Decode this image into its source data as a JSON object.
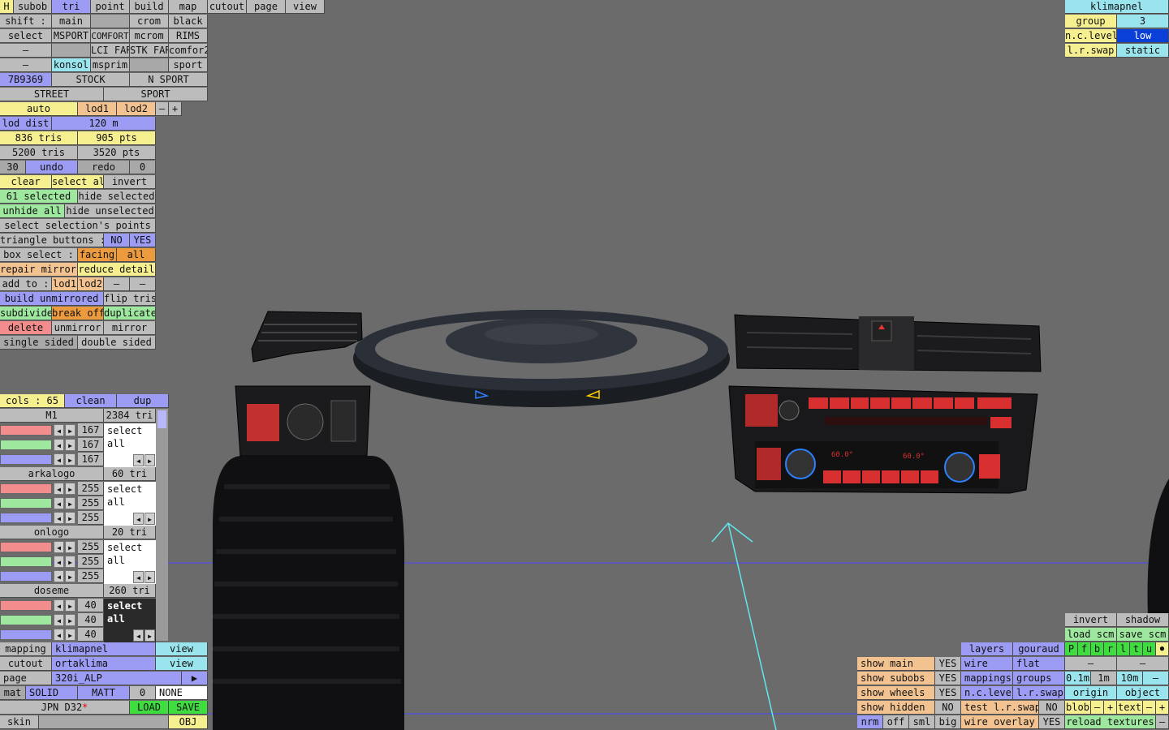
{
  "toolbar": {
    "h": "H",
    "subob": "subob",
    "tri": "tri",
    "point": "point",
    "build": "build",
    "map": "map",
    "cutout": "cutout",
    "page": "page",
    "view": "view"
  },
  "shift": {
    "label": "shift :",
    "main": "main",
    "crom": "crom",
    "black": "black"
  },
  "selectrow": {
    "label": "select",
    "msport": "MSPORT",
    "comfort": "COMFORT",
    "mcrom": "mcrom",
    "rims": "RIMS"
  },
  "row4": {
    "dash": "–",
    "lcifar": "LCI FAR",
    "stkfar": "STK FAR",
    "comfor2": "comfor2"
  },
  "row5": {
    "dash": "–",
    "konsol": "konsol",
    "msprim": "msprim",
    "sport": "sport"
  },
  "row6": {
    "id": "7B9369",
    "stock": "STOCK",
    "nsport": "N SPORT"
  },
  "row7": {
    "street": "STREET",
    "sport": "SPORT"
  },
  "lod": {
    "auto": "auto",
    "lod1": "lod1",
    "lod2": "lod2",
    "minus": "–",
    "plus": "+",
    "dist_label": "lod dist",
    "dist_value": "120 m",
    "tris1": "836 tris",
    "pts1": "905 pts",
    "tris2": "5200 tris",
    "pts2": "3520 pts"
  },
  "undo": {
    "n": "30",
    "undo": "undo",
    "redo": "redo",
    "m": "0"
  },
  "ops": {
    "clear": "clear",
    "select_all": "select all",
    "invert": "invert",
    "selected": "61 selected",
    "hide_selected": "hide selected",
    "unhide_all": "unhide all",
    "hide_unselected": "hide unselected",
    "select_points": "select selection's points",
    "tri_buttons": "triangle buttons :",
    "no": "NO",
    "yes": "YES",
    "box_select": "box select :",
    "facing": "facing",
    "all": "all",
    "repair_mirroring": "repair mirroring",
    "reduce_detail": "reduce detail",
    "add_to": "add to :",
    "lod1": "lod1",
    "lod2": "lod2",
    "dash": "–",
    "build_unmirrored": "build unmirrored",
    "flip_tris": "flip tris",
    "subdivide": "subdivide",
    "break_off": "break off",
    "duplicate": "duplicate",
    "delete": "delete",
    "unmirror": "unmirror",
    "mirror": "mirror",
    "single_sided": "single sided",
    "double_sided": "double sided"
  },
  "materials": {
    "cols": "cols : 65",
    "clean": "clean",
    "dup": "dup",
    "items": [
      {
        "name": "M1",
        "tris": "2384 tri",
        "vals": [
          "167",
          "167",
          "167"
        ],
        "action": "select all"
      },
      {
        "name": "arkalogo",
        "tris": "60 tri",
        "vals": [
          "255",
          "255",
          "255"
        ],
        "action": "select all"
      },
      {
        "name": "onlogo",
        "tris": "20 tri",
        "vals": [
          "255",
          "255",
          "255"
        ],
        "action": "select all"
      },
      {
        "name": "doseme",
        "tris": "260 tri",
        "vals": [
          "40",
          "40",
          "40"
        ],
        "action": "select all"
      }
    ]
  },
  "bottom_left": {
    "mapping": "mapping",
    "mapping_val": "klimapnel",
    "view": "view",
    "cutout": "cutout",
    "cutout_val": "ortaklima",
    "page": "page",
    "page_val": "320i_ALP",
    "play": "▶",
    "mat": "mat",
    "solid": "SOLID",
    "matt": "MATT",
    "zero": "0",
    "none": "NONE",
    "jpn": "JPN D32",
    "star": "*",
    "load": "LOAD",
    "save": "SAVE",
    "skin": "skin",
    "obj": "OBJ"
  },
  "top_right": {
    "title": "klimapnel",
    "group": "group",
    "group_val": "3",
    "nclevel": "n.c.level",
    "low": "low",
    "lrswap": "l.r.swap",
    "static": "static"
  },
  "bottom_right": {
    "invert": "invert",
    "shadow": "shadow",
    "load_scm": "load scm",
    "save_scm": "save scm",
    "flags": [
      "P",
      "f",
      "b",
      "r",
      "l",
      "t",
      "u"
    ],
    "dot": "●",
    "layers": "layers",
    "gouraud": "gouraud",
    "wire": "wire",
    "flat": "flat",
    "show_main": "show main",
    "show_subobs": "show subobs",
    "show_wheels": "show wheels",
    "show_hidden": "show hidden",
    "yes": "YES",
    "no": "NO",
    "mappings": "mappings",
    "groups": "groups",
    "nclevel": "n.c.level",
    "lrswap": "l.r.swap",
    "test_lrswap": "test l.r.swap",
    "s01": "0.1m",
    "s1": "1m",
    "s10": "10m",
    "dash": "–",
    "origin": "origin",
    "object": "object",
    "blob": "blob",
    "minus": "–",
    "plus": "+",
    "text": "text",
    "nrm": "nrm",
    "off": "off",
    "sml": "sml",
    "big": "big",
    "wire_overlay": "wire overlay",
    "reload_textures": "reload textures"
  },
  "viewport": {
    "hud_temp_l": "60.0°",
    "hud_temp_r": "60.0°"
  }
}
